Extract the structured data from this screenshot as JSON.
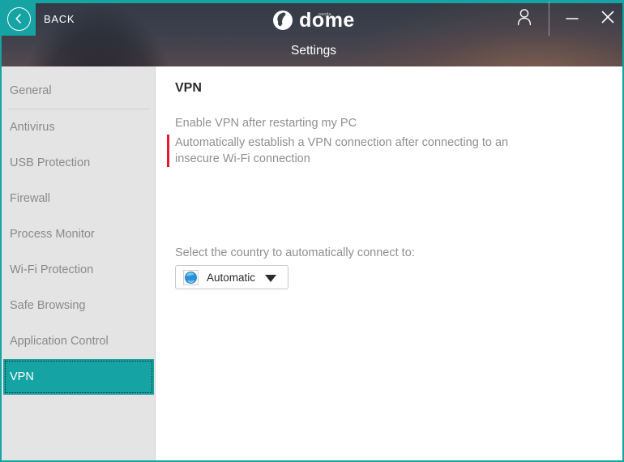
{
  "window": {
    "accent_color": "#16a3a3",
    "back_label": "BACK",
    "brand_name": "dome",
    "brand_super": "panda",
    "section_title": "Settings",
    "account_icon": "user-icon",
    "minimize_icon": "minimize-icon",
    "close_icon": "close-icon",
    "back_icon": "chevron-left-icon"
  },
  "sidebar": {
    "items": [
      {
        "label": "General"
      },
      {
        "label": "Antivirus"
      },
      {
        "label": "USB Protection"
      },
      {
        "label": "Firewall"
      },
      {
        "label": "Process Monitor"
      },
      {
        "label": "Wi-Fi Protection"
      },
      {
        "label": "Safe Browsing"
      },
      {
        "label": "Application Control"
      },
      {
        "label": "VPN"
      }
    ],
    "active_label": "VPN"
  },
  "content": {
    "title": "VPN",
    "settings": [
      {
        "label": "Enable VPN after restarting my PC",
        "toggle_state": "off",
        "accent": "none"
      },
      {
        "label": "Automatically establish a VPN connection after connecting to an insecure Wi-Fi connection",
        "toggle_state": "off",
        "accent": "#e8142d"
      }
    ],
    "country_label": "Select the country to automatically connect to:",
    "country_value": "Automatic",
    "country_icon": "globe-icon",
    "country_caret_icon": "caret-down-icon"
  }
}
